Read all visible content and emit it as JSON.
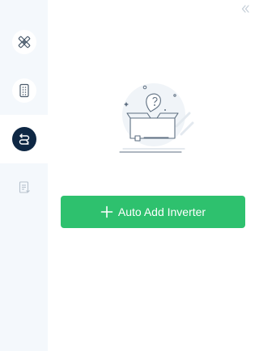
{
  "sidebar": {
    "items": [
      {
        "name": "settings",
        "icon": "tools-icon",
        "active": false
      },
      {
        "name": "device",
        "icon": "device-icon",
        "active": false
      },
      {
        "name": "connection",
        "icon": "link-icon",
        "active": true
      },
      {
        "name": "log",
        "icon": "document-icon",
        "active": false
      }
    ]
  },
  "toolbar": {
    "collapse_icon": "double-chevron-left-icon"
  },
  "main": {
    "illustration_icon": "empty-box-question-icon",
    "button_label": "Auto Add Inverter",
    "button_icon": "plus-icon"
  },
  "colors": {
    "accent": "#2ec16e",
    "active_nav": "#0e2744",
    "sidebar_bg": "#f4f8fc"
  }
}
